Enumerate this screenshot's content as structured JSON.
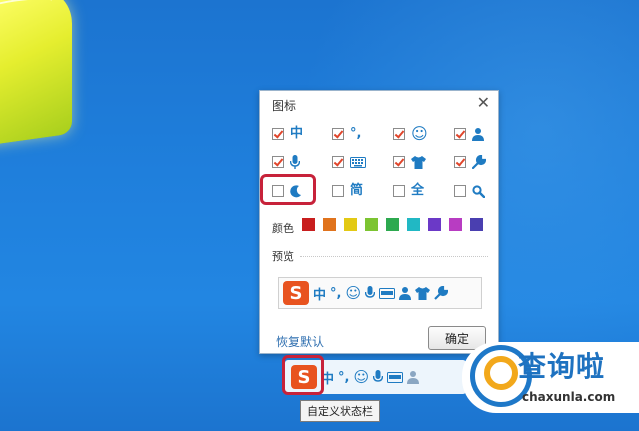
{
  "dialog": {
    "title": "图标",
    "close": "✕",
    "options": [
      {
        "icon": "zh",
        "text": "中",
        "checked": true
      },
      {
        "icon": "punct",
        "text": "°,",
        "checked": true
      },
      {
        "icon": "smile",
        "text": "☺",
        "checked": true
      },
      {
        "icon": "user",
        "text": "",
        "checked": true
      },
      {
        "icon": "mic",
        "text": "",
        "checked": true
      },
      {
        "icon": "keyboard",
        "text": "",
        "checked": true
      },
      {
        "icon": "shirt",
        "text": "",
        "checked": true
      },
      {
        "icon": "wrench",
        "text": "",
        "checked": true
      },
      {
        "icon": "moon",
        "text": "",
        "checked": false
      },
      {
        "icon": "simplified",
        "text": "简",
        "checked": false
      },
      {
        "icon": "fullwidth",
        "text": "全",
        "checked": false
      },
      {
        "icon": "search",
        "text": "",
        "checked": false
      }
    ],
    "color_label": "颜色",
    "colors": [
      "#c81e1e",
      "#e0731d",
      "#e3c914",
      "#7cc431",
      "#2da94f",
      "#21b8c4",
      "#6b39c7",
      "#b83cc2",
      "#4a3fb0"
    ],
    "preview_label": "预览",
    "preview": {
      "logo": "S",
      "zh": "中",
      "punct": "°,"
    },
    "restore_label": "恢复默认",
    "ok_label": "确定"
  },
  "statusbar": {
    "logo": "S",
    "zh": "中",
    "punct": "°,"
  },
  "tooltip": "自定义状态栏",
  "watermark": {
    "name": "查询啦",
    "url": "chaxunla.com"
  },
  "accent": "#1f7bc2"
}
